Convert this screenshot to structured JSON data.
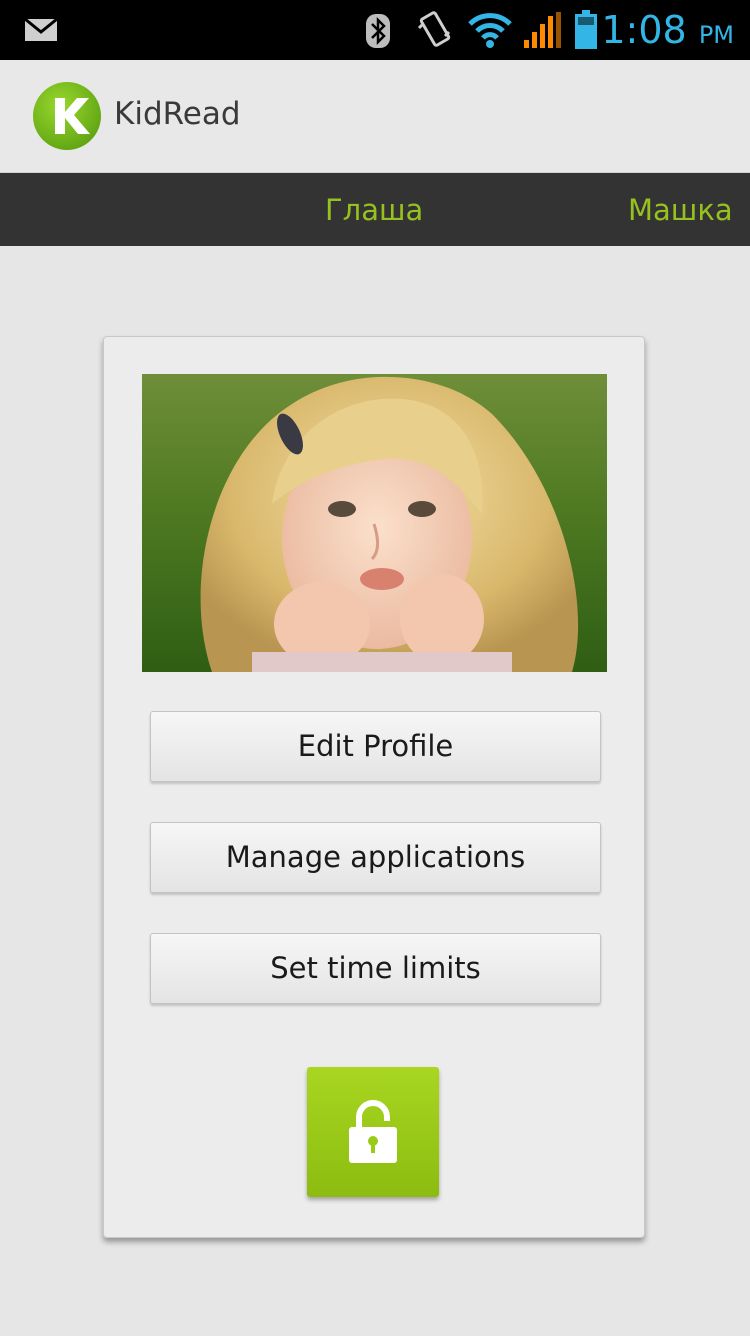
{
  "status_bar": {
    "time": "1:08",
    "ampm": "PM",
    "time_color": "#33b5e5",
    "icons": [
      "mail-icon",
      "bluetooth-icon",
      "vibrate-icon",
      "wifi-icon",
      "signal-icon",
      "battery-icon"
    ]
  },
  "app_bar": {
    "title": "KidRead",
    "logo_letter": "K",
    "logo_color": "#7cc21b"
  },
  "tabs": [
    {
      "label": "Глаша"
    },
    {
      "label": "Машка"
    }
  ],
  "tab_color": "#97c11e",
  "profile": {
    "buttons": {
      "edit_profile": "Edit Profile",
      "manage_applications": "Manage applications",
      "set_time_limits": "Set time limits"
    },
    "lock_button_icon": "unlock-icon",
    "lock_color": "#9acb19"
  }
}
